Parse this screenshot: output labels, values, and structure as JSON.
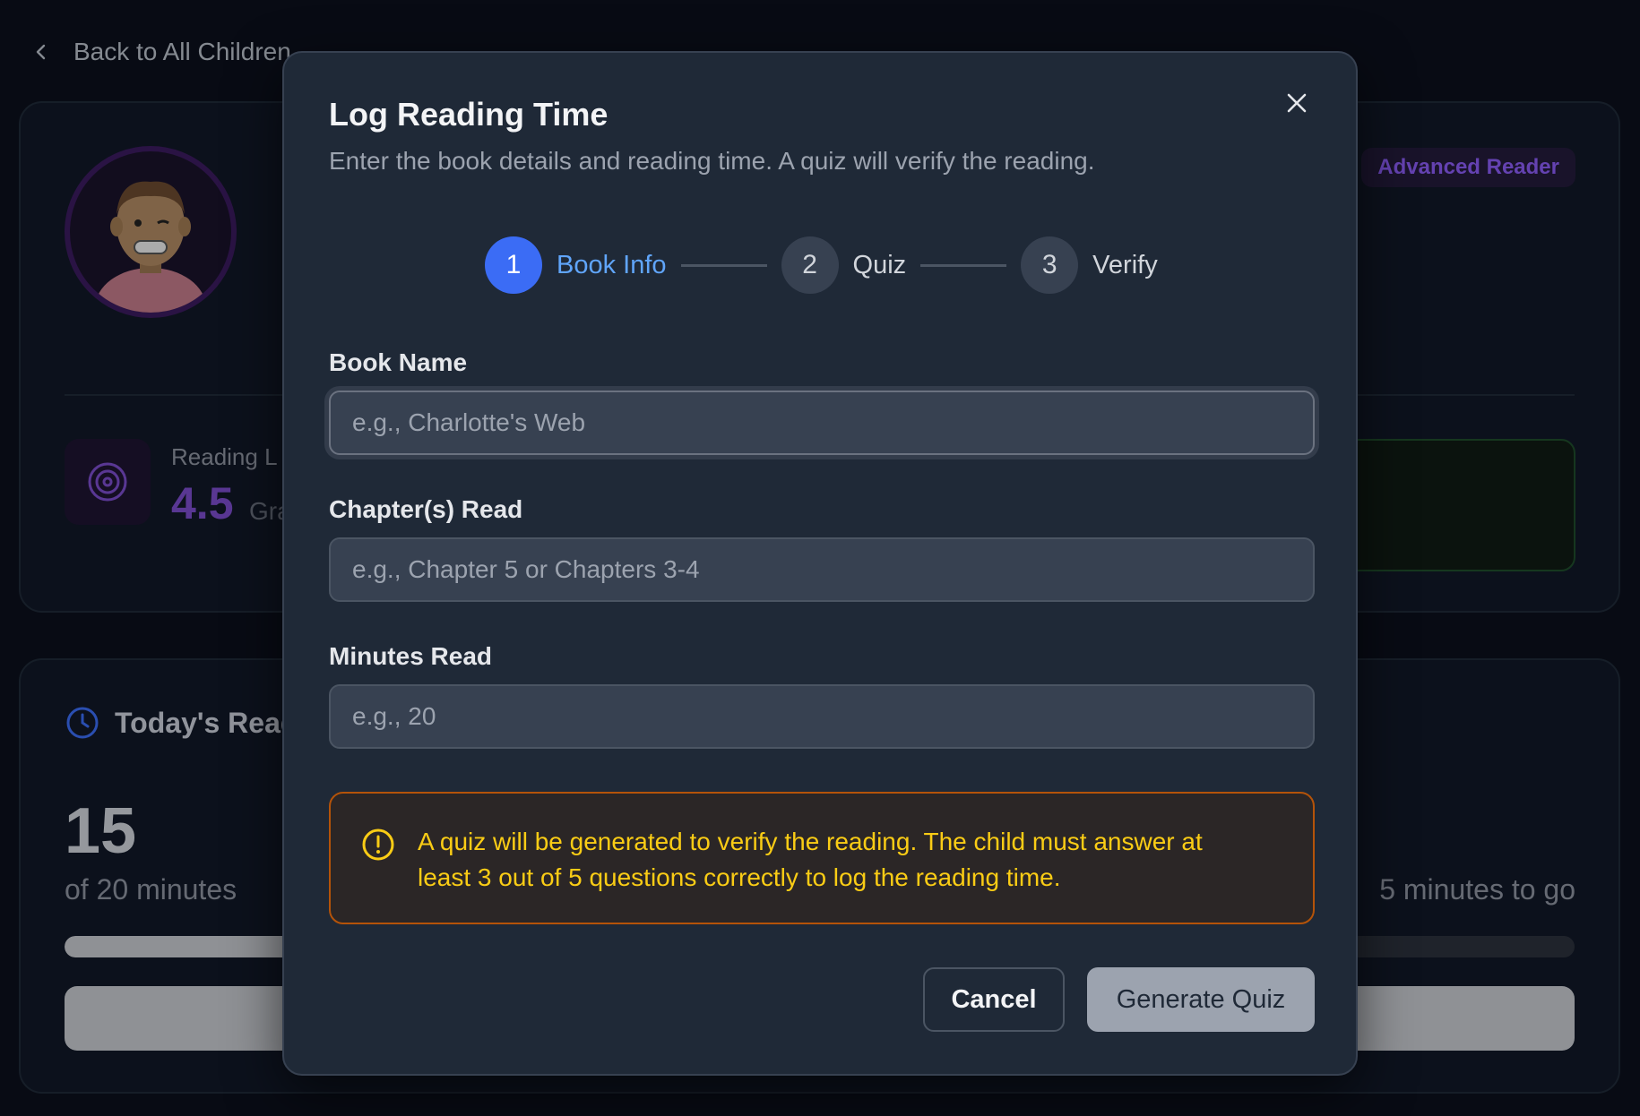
{
  "background": {
    "back_link": "Back to All Children",
    "profile": {
      "badge": "Advanced Reader",
      "reading_level_label": "Reading L",
      "reading_level_value": "4.5",
      "reading_level_unit": "Gra"
    },
    "today": {
      "title": "Today's Read",
      "minutes_read": "15",
      "of_minutes": "of 20 minutes",
      "to_go": "5 minutes to go",
      "progress_fraction": 0.75
    }
  },
  "modal": {
    "title": "Log Reading Time",
    "description": "Enter the book details and reading time. A quiz will verify the reading.",
    "steps": [
      {
        "number": "1",
        "label": "Book Info",
        "active": true
      },
      {
        "number": "2",
        "label": "Quiz",
        "active": false
      },
      {
        "number": "3",
        "label": "Verify",
        "active": false
      }
    ],
    "fields": {
      "book_name": {
        "label": "Book Name",
        "placeholder": "e.g., Charlotte's Web",
        "value": ""
      },
      "chapters": {
        "label": "Chapter(s) Read",
        "placeholder": "e.g., Chapter 5 or Chapters 3-4",
        "value": ""
      },
      "minutes": {
        "label": "Minutes Read",
        "placeholder": "e.g., 20",
        "value": ""
      }
    },
    "notice": "A quiz will be generated to verify the reading. The child must answer at least 3 out of 5 questions correctly to log the reading time.",
    "buttons": {
      "cancel": "Cancel",
      "generate": "Generate Quiz"
    }
  },
  "colors": {
    "accent": "#3b6cf5",
    "step_active_label": "#60a5fa",
    "notice_border": "#b45309",
    "notice_text": "#facc15",
    "badge_text": "#8b5cf6"
  }
}
